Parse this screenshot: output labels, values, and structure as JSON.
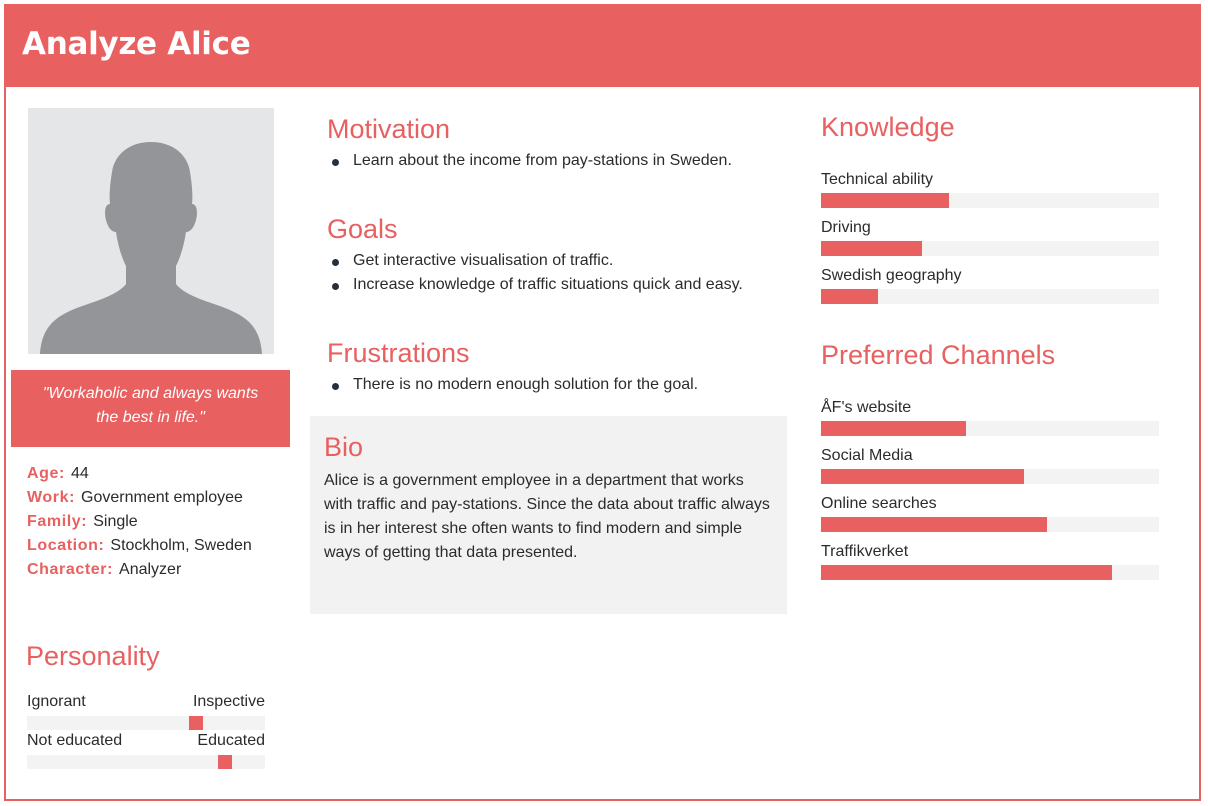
{
  "title": "Analyze Alice",
  "colors": {
    "accent": "#e86060",
    "panel": "#f2f2f2",
    "track": "#f3f3f3"
  },
  "photo_icon": "person-silhouette-icon",
  "quote": "\"Workaholic and always wants the best in life.\"",
  "facts": [
    {
      "key": "Age:",
      "value": "44"
    },
    {
      "key": "Work:",
      "value": "Government employee"
    },
    {
      "key": "Family:",
      "value": "Single"
    },
    {
      "key": "Location:",
      "value": "Stockholm, Sweden"
    },
    {
      "key": "Character:",
      "value": "Analyzer"
    }
  ],
  "personality": {
    "title": "Personality",
    "scales": [
      {
        "left": "Ignorant",
        "right": "Inspective",
        "value": 0.71
      },
      {
        "left": "Not educated",
        "right": "Educated",
        "value": 0.83
      }
    ]
  },
  "motivation": {
    "title": "Motivation",
    "items": [
      "Learn about the income from pay-stations in Sweden."
    ]
  },
  "goals": {
    "title": "Goals",
    "items": [
      "Get interactive visualisation of traffic.",
      "Increase knowledge of traffic situations quick and easy."
    ]
  },
  "frustrations": {
    "title": "Frustrations",
    "items": [
      "There is no modern enough solution for the goal."
    ]
  },
  "bio": {
    "title": "Bio",
    "text": "Alice is a government employee in a department that works with traffic and pay-stations. Since the data about traffic always is in her interest she often wants to find modern and simple ways of getting that data presented."
  },
  "knowledge": {
    "title": "Knowledge",
    "items": [
      {
        "label": "Technical ability",
        "value": 0.38
      },
      {
        "label": "Driving",
        "value": 0.3
      },
      {
        "label": "Swedish geography",
        "value": 0.17
      }
    ]
  },
  "channels": {
    "title": "Preferred Channels",
    "items": [
      {
        "label": "ÅF's website",
        "value": 0.43
      },
      {
        "label": "Social Media",
        "value": 0.6
      },
      {
        "label": "Online searches",
        "value": 0.67
      },
      {
        "label": "Traffikverket",
        "value": 0.86
      }
    ]
  }
}
